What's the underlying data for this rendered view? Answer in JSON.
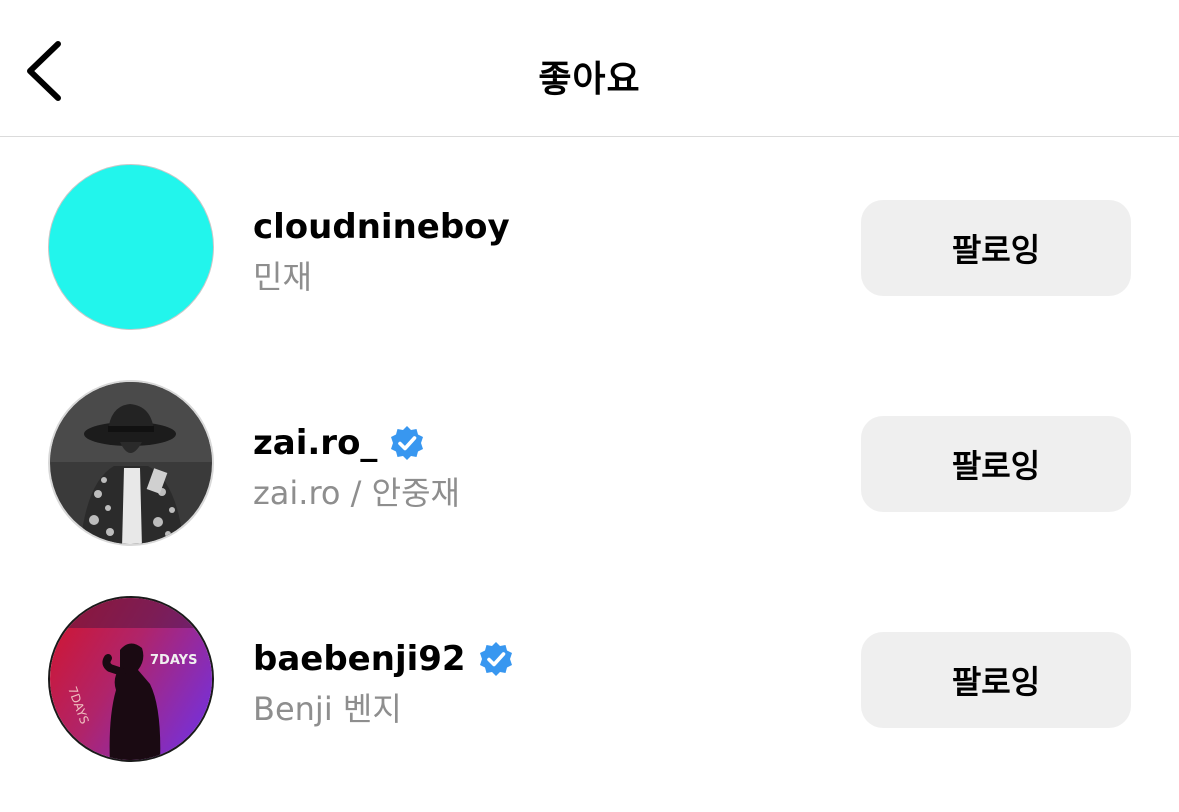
{
  "header": {
    "title": "좋아요",
    "back_icon": "chevron-left-icon"
  },
  "colors": {
    "button_bg": "#efefef",
    "secondary_text": "#8e8e8e",
    "verified_blue": "#3897f0",
    "divider": "#dbdbdb"
  },
  "users": [
    {
      "username": "cloudnineboy",
      "full_name": "민재",
      "verified": false,
      "avatar": "solid-cyan-avatar",
      "button_label": "팔로잉"
    },
    {
      "username": "zai.ro_",
      "full_name": "zai.ro / 안중재",
      "verified": true,
      "avatar": "man-in-hat-photo-avatar",
      "button_label": "팔로잉"
    },
    {
      "username": "baebenji92",
      "full_name": "Benji 벤지",
      "verified": true,
      "avatar": "7-days-album-cover-avatar",
      "button_label": "팔로잉"
    }
  ]
}
